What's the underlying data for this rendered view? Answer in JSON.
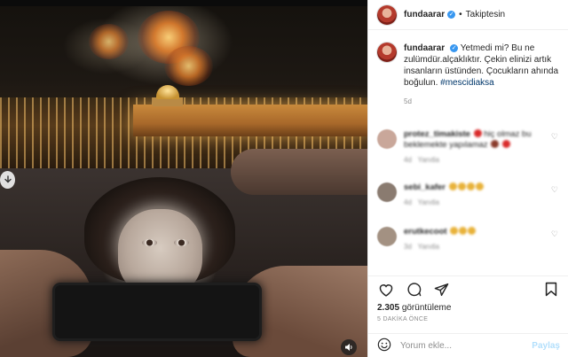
{
  "post": {
    "username": "fundaarar",
    "follow_state": "Takiptesin",
    "caption_username": "fundaarar",
    "caption_text": "Yetmedi mi? Bu ne zulümdür.alçaklıktır. Çekin elinizi artık insanların üstünden. Çocukların ahında boğulun.",
    "hashtag": "#mescidiaksa",
    "caption_age": "5d",
    "views_count": "2.305",
    "views_label": "görüntüleme",
    "time_ago": "5 DAKİKA ÖNCE"
  },
  "comments": [
    {
      "username": "protez_timakiste",
      "text": "hiç olmaz bu",
      "text2": "beklemekte yapılamaz",
      "age": "4d",
      "reply": "Yanıtla",
      "avatar_color": "#c9a79a"
    },
    {
      "username": "sebi_kafer",
      "text": "",
      "age": "4d",
      "reply": "Yanıtla",
      "avatar_color": "#8a7b70"
    },
    {
      "username": "erutkecoot",
      "text": "",
      "age": "3d",
      "reply": "Yanıtla",
      "avatar_color": "#a39182"
    }
  ],
  "comment_input": {
    "placeholder": "Yorum ekle...",
    "submit_label": "Paylaş"
  },
  "icons": {
    "verified": "verified-badge-icon",
    "like": "heart-icon",
    "comment": "comment-bubble-icon",
    "share": "paper-plane-icon",
    "save": "bookmark-icon",
    "emoji": "smiley-icon",
    "download": "arrow-down-icon",
    "sound": "speaker-icon"
  },
  "colors": {
    "accent_blue": "#3897f0",
    "hashtag": "#00376b",
    "muted": "#8e8e8e",
    "share_disabled": "#b2dffc"
  }
}
